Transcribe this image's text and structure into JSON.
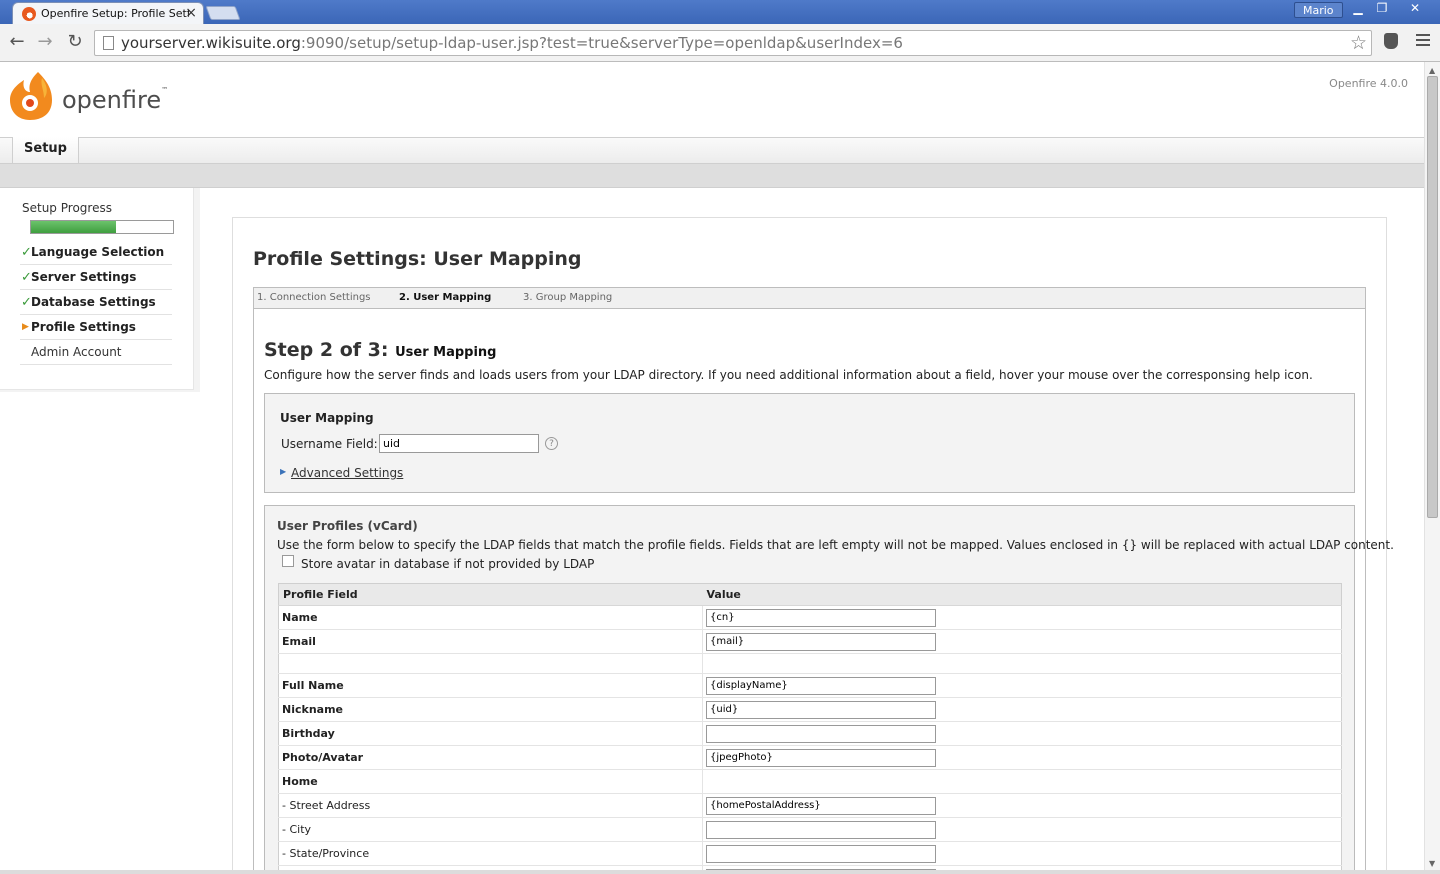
{
  "browser": {
    "tab_title": "Openfire Setup: Profile Settings",
    "tab_close": "×",
    "user": "Mario",
    "url_host": "yourserver.wikisuite.org",
    "url_rest": ":9090/setup/setup-ldap-user.jsp?test=true&serverType=openldap&userIndex=6",
    "icons": [
      "back-icon",
      "forward-icon",
      "reload-icon",
      "page-icon",
      "star-icon",
      "extension-icon",
      "menu-icon"
    ]
  },
  "header": {
    "logo_text": "openfire",
    "logo_tm": "™",
    "version": "Openfire 4.0.0",
    "tab_label": "Setup"
  },
  "sidebar": {
    "progress_label": "Setup Progress",
    "progress_fraction": 0.6,
    "steps": [
      {
        "label": "Language Selection",
        "state": "done"
      },
      {
        "label": "Server Settings",
        "state": "done"
      },
      {
        "label": "Database Settings",
        "state": "done"
      },
      {
        "label": "Profile Settings",
        "state": "current"
      },
      {
        "label": "Admin Account",
        "state": "pending"
      }
    ]
  },
  "main": {
    "title": "Profile Settings: User Mapping",
    "subtabs": [
      "1. Connection Settings",
      "2. User Mapping",
      "3. Group Mapping"
    ],
    "active_subtab": 1,
    "step_heading": "Step 2 of 3:",
    "step_sub": "User Mapping",
    "step_desc": "Configure how the server finds and loads users from your LDAP directory. If you need additional information about a field, hover your mouse over the corresponsing help icon.",
    "user_mapping": {
      "title": "User Mapping",
      "username_label": "Username Field:",
      "username_value": "uid",
      "help": "?",
      "advanced_link": "Advanced Settings"
    },
    "vcard": {
      "title": "User Profiles (vCard)",
      "desc": "Use the form below to specify the LDAP fields that match the profile fields. Fields that are left empty will not be mapped. Values enclosed in {} will be replaced with actual LDAP content.",
      "avatar_label": "Store avatar in database if not provided by LDAP",
      "col_field": "Profile Field",
      "col_value": "Value",
      "rows": [
        {
          "label": "Name",
          "value": "{cn}",
          "input": true,
          "sub": false
        },
        {
          "label": "Email",
          "value": "{mail}",
          "input": true,
          "sub": false
        },
        {
          "label": "",
          "value": "",
          "input": false,
          "sub": false,
          "spacer": true
        },
        {
          "label": "Full Name",
          "value": "{displayName}",
          "input": true,
          "sub": false
        },
        {
          "label": "Nickname",
          "value": "{uid}",
          "input": true,
          "sub": false
        },
        {
          "label": "Birthday",
          "value": "",
          "input": true,
          "sub": false
        },
        {
          "label": "Photo/Avatar",
          "value": "{jpegPhoto}",
          "input": true,
          "sub": false
        },
        {
          "label": "Home",
          "value": "",
          "input": false,
          "sub": false
        },
        {
          "label": "- Street Address",
          "value": "{homePostalAddress}",
          "input": true,
          "sub": true
        },
        {
          "label": "- City",
          "value": "",
          "input": true,
          "sub": true
        },
        {
          "label": "- State/Province",
          "value": "",
          "input": true,
          "sub": true
        },
        {
          "label": "",
          "value": "",
          "input": true,
          "sub": true
        }
      ]
    }
  }
}
